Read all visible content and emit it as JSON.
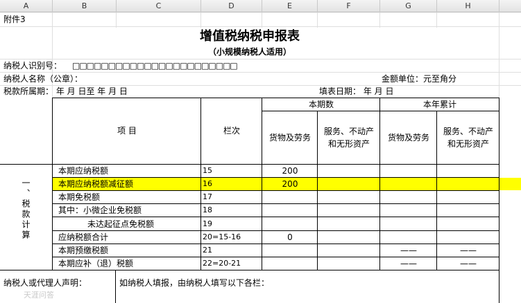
{
  "columns": [
    "A",
    "B",
    "C",
    "D",
    "E",
    "F",
    "G",
    "H"
  ],
  "attachment": "附件3",
  "title": "增值税纳税申报表",
  "subtitle": "（小规模纳税人适用）",
  "taxpayer_id_label": "纳税人识别号：",
  "taxpayer_id_boxes": "□□□□□□□□□□□□□□□□□□□□□□□",
  "taxpayer_name_label": "纳税人名称（公章）：",
  "amount_unit": "金额单位：元至角分",
  "tax_period": "税款所属期：     年  月  日至    年  月  日",
  "fill_date": "填表日期：    年  月  日",
  "header": {
    "item": "项    目",
    "line": "栏次",
    "current": "本期数",
    "ytd": "本年累计",
    "goods": "货物及劳务",
    "services_l1": "服务、不动产",
    "services_l2": "和无形资产"
  },
  "section_label": "一、税款计算",
  "rows": [
    {
      "item": "本期应纳税额",
      "line": "15",
      "goods": "200",
      "ytd_goods": "",
      "ytd_services": ""
    },
    {
      "item": "本期应纳税额减征额",
      "line": "16",
      "goods": "200",
      "ytd_goods": "",
      "ytd_services": ""
    },
    {
      "item": "本期免税额",
      "line": "17",
      "goods": "",
      "ytd_goods": "",
      "ytd_services": ""
    },
    {
      "item": "其中：小微企业免税额",
      "line": "18",
      "goods": "",
      "ytd_goods": "",
      "ytd_services": ""
    },
    {
      "item": "未达起征点免税额",
      "line": "19",
      "goods": "",
      "ytd_goods": "",
      "ytd_services": ""
    },
    {
      "item": "应纳税额合计",
      "line": "20=15-16",
      "goods": "0",
      "ytd_goods": "",
      "ytd_services": ""
    },
    {
      "item": "本期预缴税额",
      "line": "21",
      "goods": "",
      "ytd_goods": "——",
      "ytd_services": "——"
    },
    {
      "item": "本期应补（退）税额",
      "line": "22=20-21",
      "goods": "",
      "ytd_goods": "——",
      "ytd_services": "——"
    }
  ],
  "declaration_label": "纳税人或代理人声明：",
  "declaration_text": "如纳税人填报，由纳税人填写以下各栏：",
  "watermark": "天涯问答",
  "highlight_color": "#ffff00"
}
